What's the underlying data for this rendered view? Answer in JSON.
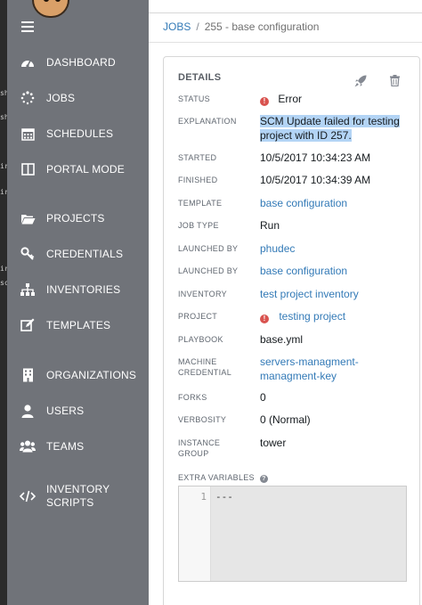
{
  "terminal_fragments": [
    "sh",
    "sh",
    "ir",
    "ir",
    "ir",
    "sc"
  ],
  "sidebar": {
    "items": [
      {
        "label": "DASHBOARD",
        "icon": "dashboard-icon"
      },
      {
        "label": "JOBS",
        "icon": "jobs-spinner-icon"
      },
      {
        "label": "SCHEDULES",
        "icon": "calendar-icon"
      },
      {
        "label": "PORTAL MODE",
        "icon": "portal-icon"
      },
      {
        "label": "PROJECTS",
        "icon": "folder-icon"
      },
      {
        "label": "CREDENTIALS",
        "icon": "key-icon"
      },
      {
        "label": "INVENTORIES",
        "icon": "sitemap-icon"
      },
      {
        "label": "TEMPLATES",
        "icon": "edit-icon"
      },
      {
        "label": "ORGANIZATIONS",
        "icon": "building-icon"
      },
      {
        "label": "USERS",
        "icon": "user-icon"
      },
      {
        "label": "TEAMS",
        "icon": "users-icon"
      },
      {
        "label": "INVENTORY SCRIPTS",
        "icon": "code-icon"
      }
    ]
  },
  "breadcrumb": {
    "root": "JOBS",
    "separator": "/",
    "current": "255 - base configuration"
  },
  "details": {
    "title": "DETAILS",
    "status": {
      "label": "STATUS",
      "value": "Error"
    },
    "explanation": {
      "label": "EXPLANATION",
      "value": "SCM Update failed for testing project with ID 257."
    },
    "started": {
      "label": "STARTED",
      "value": "10/5/2017 10:34:23 AM"
    },
    "finished": {
      "label": "FINISHED",
      "value": "10/5/2017 10:34:39 AM"
    },
    "template": {
      "label": "TEMPLATE",
      "value": "base configuration"
    },
    "job_type": {
      "label": "JOB TYPE",
      "value": "Run"
    },
    "launched_by_1": {
      "label": "LAUNCHED BY",
      "value": "phudec"
    },
    "launched_by_2": {
      "label": "LAUNCHED BY",
      "value": "base configuration"
    },
    "inventory": {
      "label": "INVENTORY",
      "value": "test project inventory"
    },
    "project": {
      "label": "PROJECT",
      "value": "testing project"
    },
    "playbook": {
      "label": "PLAYBOOK",
      "value": "base.yml"
    },
    "machine_credential": {
      "label": "MACHINE CREDENTIAL",
      "value": "servers-managment-managment-key"
    },
    "forks": {
      "label": "FORKS",
      "value": "0"
    },
    "verbosity": {
      "label": "VERBOSITY",
      "value": "0 (Normal)"
    },
    "instance_group": {
      "label": "INSTANCE GROUP",
      "value": "tower"
    },
    "extra_variables": {
      "label": "EXTRA VARIABLES",
      "line_number": "1",
      "code": "---"
    }
  },
  "colors": {
    "sidebar_bg": "#707379",
    "link": "#337ab7",
    "error": "#d9534f",
    "highlight": "#b3d4f5"
  }
}
